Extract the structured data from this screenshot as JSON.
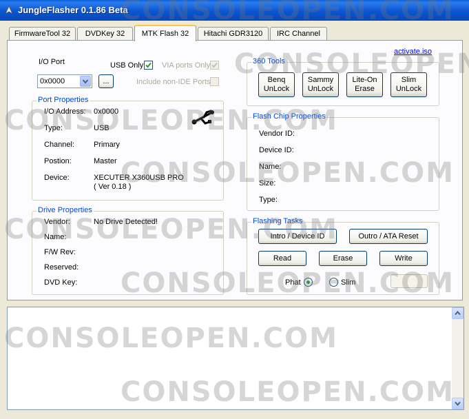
{
  "window": {
    "title": "JungleFlasher 0.1.86 Beta"
  },
  "tabs": [
    {
      "label": "FirmwareTool 32"
    },
    {
      "label": "DVDKey 32"
    },
    {
      "label": "MTK Flash 32"
    },
    {
      "label": "Hitachi GDR3120"
    },
    {
      "label": "IRC Channel"
    }
  ],
  "active_tab": "MTK Flash 32",
  "io_port": {
    "label": "I/O Port",
    "value": "0x0000",
    "browse_label": "...",
    "usb_only_label": "USB Only",
    "usb_only_checked": true,
    "via_ports_label": "VIA ports Only",
    "via_ports_checked": true,
    "non_ide_label": "Include non-IDE Ports",
    "non_ide_checked": false
  },
  "activate_link": "activate.iso",
  "tools_360": {
    "title": "360 Tools",
    "buttons": [
      {
        "line1": "Benq",
        "line2": "UnLock"
      },
      {
        "line1": "Sammy",
        "line2": "UnLock"
      },
      {
        "line1": "Lite-On",
        "line2": "Erase"
      },
      {
        "line1": "Slim",
        "line2": "UnLock"
      }
    ]
  },
  "port_properties": {
    "title": "Port Properties",
    "rows": [
      {
        "label": "I/O Address:",
        "value": "0x0000"
      },
      {
        "label": "Type:",
        "value": "USB"
      },
      {
        "label": "Channel:",
        "value": "Primary"
      },
      {
        "label": "Postion:",
        "value": "Master"
      },
      {
        "label": "Device:",
        "value": "XECUTER X360USB PRO",
        "value2": "( Ver 0.18 )"
      }
    ],
    "icon": "usb-icon"
  },
  "flash_chip": {
    "title": "Flash Chip Properties",
    "rows": [
      {
        "label": "Vendor ID:"
      },
      {
        "label": "Device ID:"
      },
      {
        "label": "Name:"
      },
      {
        "label": "Size:"
      },
      {
        "label": "Type:"
      }
    ]
  },
  "drive_properties": {
    "title": "Drive Properties",
    "rows": [
      {
        "label": "Vendor:",
        "value": "No Drive Detected!"
      },
      {
        "label": "Name:",
        "value": ""
      },
      {
        "label": "F/W Rev:",
        "value": ""
      },
      {
        "label": "Reserved:",
        "value": ""
      },
      {
        "label": "DVD Key:",
        "value": ""
      }
    ]
  },
  "flashing_tasks": {
    "title": "Flashing Tasks",
    "intro_label": "Intro / Device ID",
    "outro_label": "Outro / ATA Reset",
    "read_label": "Read",
    "erase_label": "Erase",
    "write_label": "Write",
    "phat_label": "Phat",
    "slim_label": "Slim",
    "selected": "Phat"
  },
  "watermark": "CONSOLEOPEN.COM",
  "colors": {
    "titlebar": "#0b55d0",
    "group_title": "#0046d5",
    "window_bg": "#ece9d8",
    "tab_highlight": "#ffc83c"
  }
}
